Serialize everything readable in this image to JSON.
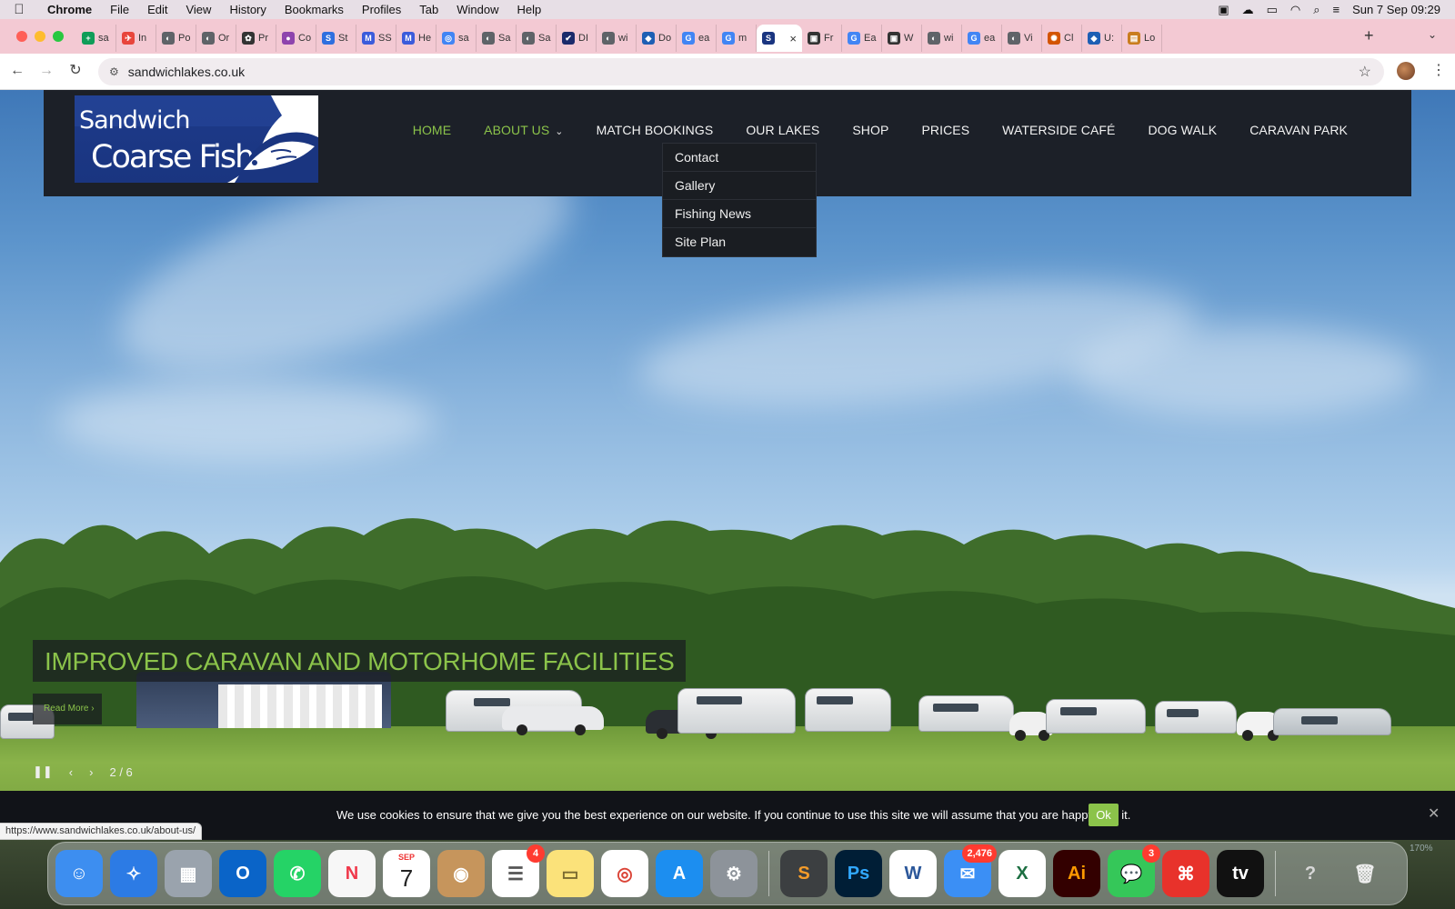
{
  "menubar": {
    "app": "Chrome",
    "items": [
      "File",
      "Edit",
      "View",
      "History",
      "Bookmarks",
      "Profiles",
      "Tab",
      "Window",
      "Help"
    ],
    "datetime": "Sun 7 Sep  09:29"
  },
  "tabs": [
    {
      "label": "sa",
      "color": "#0f9d58",
      "glyph": "+"
    },
    {
      "label": "In",
      "color": "#e8453c",
      "glyph": "✈"
    },
    {
      "label": "Po",
      "color": "#5f6368",
      "glyph": "◐"
    },
    {
      "label": "Or",
      "color": "#5f6368",
      "glyph": "◐"
    },
    {
      "label": "Pr",
      "color": "#333333",
      "glyph": "✿"
    },
    {
      "label": "Co",
      "color": "#8e44ad",
      "glyph": "●"
    },
    {
      "label": "St",
      "color": "#2f6fdf",
      "glyph": "S"
    },
    {
      "label": "SS",
      "color": "#3b5bdb",
      "glyph": "M"
    },
    {
      "label": "He",
      "color": "#3b5bdb",
      "glyph": "M"
    },
    {
      "label": "sa",
      "color": "#4285f4",
      "glyph": "◎"
    },
    {
      "label": "Sa",
      "color": "#5f6368",
      "glyph": "◐"
    },
    {
      "label": "Sa",
      "color": "#5f6368",
      "glyph": "◐"
    },
    {
      "label": "DI",
      "color": "#1b2a6b",
      "glyph": "✔"
    },
    {
      "label": "wi",
      "color": "#5f6368",
      "glyph": "◐"
    },
    {
      "label": "Do",
      "color": "#1e5fb4",
      "glyph": "◆"
    },
    {
      "label": "ea",
      "color": "#4285f4",
      "glyph": "G"
    },
    {
      "label": "m",
      "color": "#4285f4",
      "glyph": "G"
    },
    {
      "label": "",
      "color": "#1a3580",
      "glyph": "S",
      "active": true
    },
    {
      "label": "Fr",
      "color": "#333333",
      "glyph": "▣"
    },
    {
      "label": "Ea",
      "color": "#4285f4",
      "glyph": "G"
    },
    {
      "label": "W",
      "color": "#333333",
      "glyph": "▣"
    },
    {
      "label": "wi",
      "color": "#5f6368",
      "glyph": "◐"
    },
    {
      "label": "ea",
      "color": "#4285f4",
      "glyph": "G"
    },
    {
      "label": "Vi",
      "color": "#5f6368",
      "glyph": "◐"
    },
    {
      "label": "Cl",
      "color": "#d35400",
      "glyph": "✺"
    },
    {
      "label": "U:",
      "color": "#1e5fb4",
      "glyph": "◆"
    },
    {
      "label": "Lo",
      "color": "#c97d1e",
      "glyph": "▤"
    }
  ],
  "address": {
    "url": "sandwichlakes.co.uk"
  },
  "site": {
    "logo": {
      "line1": "Sandwich",
      "line2": "Coarse Fishery"
    },
    "nav": [
      {
        "label": "HOME",
        "active": true
      },
      {
        "label": "ABOUT US",
        "active": true,
        "dropdown": true
      },
      {
        "label": "MATCH BOOKINGS"
      },
      {
        "label": "OUR LAKES"
      },
      {
        "label": "SHOP"
      },
      {
        "label": "PRICES"
      },
      {
        "label": "WATERSIDE CAFÉ"
      },
      {
        "label": "DOG WALK"
      },
      {
        "label": "CARAVAN PARK"
      }
    ],
    "about_dropdown": [
      "Contact",
      "Gallery",
      "Fishing News",
      "Site Plan"
    ],
    "slide": {
      "caption": "IMPROVED CARAVAN AND MOTORHOME FACILITIES",
      "read_more": "Read More ›",
      "counter": "2 / 6"
    },
    "accent": "#8bc34a"
  },
  "cookie": {
    "message": "We use cookies to ensure that we give you the best experience on our website. If you continue to use this site we will assume that you are happy with it.",
    "ok": "Ok"
  },
  "status_url": "https://www.sandwichlakes.co.uk/about-us/",
  "dock": {
    "zoom": "170%",
    "apps": [
      {
        "name": "finder",
        "bg": "#3d8ef0",
        "glyph": "☺"
      },
      {
        "name": "safari",
        "bg": "#2c7be5",
        "glyph": "✧"
      },
      {
        "name": "launchpad",
        "bg": "#9aa3ad",
        "glyph": "▦"
      },
      {
        "name": "outlook",
        "bg": "#0a64c8",
        "glyph": "O"
      },
      {
        "name": "whatsapp",
        "bg": "#25d366",
        "glyph": "✆"
      },
      {
        "name": "news",
        "bg": "#f7f7f7",
        "glyph": "N",
        "fg": "#f0384b"
      },
      {
        "name": "calendar",
        "bg": "#ffffff",
        "glyph": "7",
        "fg": "#222",
        "sub": "SEP"
      },
      {
        "name": "contacts",
        "bg": "#c6955c",
        "glyph": "◉"
      },
      {
        "name": "reminders",
        "bg": "#ffffff",
        "glyph": "☰",
        "fg": "#555",
        "badge": "4"
      },
      {
        "name": "notes",
        "bg": "#fbe27a",
        "glyph": "▭",
        "fg": "#7a6a30"
      },
      {
        "name": "chrome",
        "bg": "#ffffff",
        "glyph": "◎",
        "fg": "#db4437"
      },
      {
        "name": "app-store",
        "bg": "#1c8ef0",
        "glyph": "A"
      },
      {
        "name": "system-settings",
        "bg": "#8d939a",
        "glyph": "⚙"
      },
      {
        "sep": true
      },
      {
        "name": "sublime",
        "bg": "#3c3f41",
        "glyph": "S",
        "fg": "#f59c2a"
      },
      {
        "name": "photoshop",
        "bg": "#001e36",
        "glyph": "Ps",
        "fg": "#31a8ff"
      },
      {
        "name": "word",
        "bg": "#ffffff",
        "glyph": "W",
        "fg": "#2b579a"
      },
      {
        "name": "mail",
        "bg": "#3b8ff5",
        "glyph": "✉",
        "badge": "2,476"
      },
      {
        "name": "excel",
        "bg": "#ffffff",
        "glyph": "X",
        "fg": "#1d6f42"
      },
      {
        "name": "illustrator",
        "bg": "#330000",
        "glyph": "Ai",
        "fg": "#ff9a00"
      },
      {
        "name": "messages",
        "bg": "#35c759",
        "glyph": "💬",
        "badge": "3"
      },
      {
        "name": "acrobat",
        "bg": "#e8322b",
        "glyph": "⌘"
      },
      {
        "name": "apple-tv",
        "bg": "#111111",
        "glyph": "tv"
      },
      {
        "sep": true
      },
      {
        "name": "help",
        "bg": "transparent",
        "glyph": "?",
        "fg": "#d8d8d8"
      },
      {
        "name": "trash",
        "bg": "transparent",
        "glyph": "🗑",
        "fg": "#eee"
      }
    ]
  }
}
